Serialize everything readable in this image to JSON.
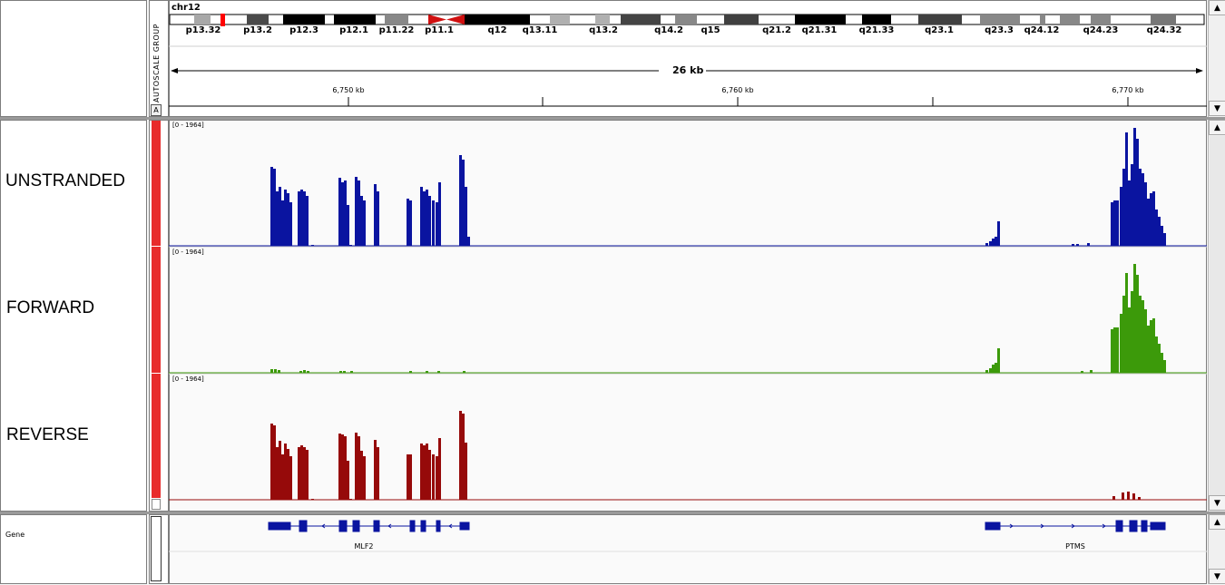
{
  "ideogram": {
    "chromosome": "chr12",
    "bands": [
      "p13.32",
      "p13.2",
      "p12.3",
      "p12.1",
      "p11.22",
      "p11.1",
      "q12",
      "q13.11",
      "q13.2",
      "q14.2",
      "q15",
      "q21.2",
      "q21.31",
      "q21.33",
      "q23.1",
      "q23.3",
      "q24.12",
      "q24.23",
      "q24.32"
    ]
  },
  "ruler": {
    "span_label": "26 kb",
    "ticks": [
      "6,750 kb",
      "6,760 kb",
      "6,770 kb"
    ],
    "autoscale_label": "AUTOSCALE GROUP",
    "autoscale_checkbox": "A"
  },
  "tracks": [
    {
      "name": "UNSTRANDED",
      "range": "[0 - 1964]",
      "color": "#0a14a0"
    },
    {
      "name": "FORWARD",
      "range": "[0 - 1964]",
      "color": "#3c9a0a"
    },
    {
      "name": "REVERSE",
      "range": "[0 - 1964]",
      "color": "#960a0a"
    }
  ],
  "gene_track": {
    "label": "Gene",
    "genes": [
      "MLF2",
      "PTMS"
    ],
    "color": "#0a14a0"
  },
  "scroll": {
    "up": "▲",
    "down": "▼"
  }
}
